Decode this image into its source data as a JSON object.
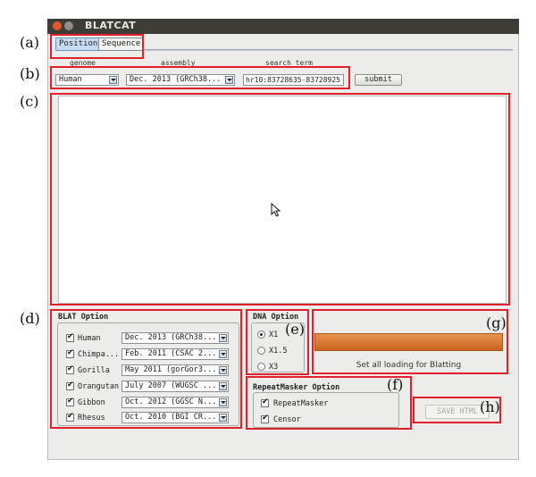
{
  "window": {
    "title": "BLATCAT"
  },
  "tabs": [
    {
      "label": "Position",
      "active": true
    },
    {
      "label": "Sequence",
      "active": false
    }
  ],
  "query": {
    "genome_label": "genome",
    "assembly_label": "assembly",
    "search_label": "search term",
    "genome_value": "Human",
    "assembly_value": "Dec. 2013 (GRCh38...",
    "search_value": "hr10:83728635-83728925",
    "submit_label": "submit"
  },
  "blat": {
    "title": "BLAT Option",
    "rows": [
      {
        "species": "Human",
        "assembly": "Dec. 2013 (GRCh38...",
        "checked": true
      },
      {
        "species": "Chimpa...",
        "assembly": "Feb. 2011 (CSAC 2...",
        "checked": true
      },
      {
        "species": "Gorilla",
        "assembly": "May 2011 (gorGor3...",
        "checked": true
      },
      {
        "species": "Orangutan",
        "assembly": "July 2007 (WUGSC ...",
        "checked": true
      },
      {
        "species": "Gibbon",
        "assembly": "Oct. 2012 (GGSC N...",
        "checked": true
      },
      {
        "species": "Rhesus",
        "assembly": "Oct. 2010 (BGI CR...",
        "checked": true
      }
    ]
  },
  "dna": {
    "title": "DNA Option",
    "options": [
      {
        "label": "X1",
        "selected": true
      },
      {
        "label": "X1.5",
        "selected": false
      },
      {
        "label": "X3",
        "selected": false
      }
    ]
  },
  "progress": {
    "value": 1.0,
    "status": "Set all loading for Blatting",
    "color": "#d8772f"
  },
  "repeatmasker": {
    "title": "RepeatMasker Option",
    "options": [
      {
        "label": "RepeatMasker",
        "checked": true
      },
      {
        "label": "Censor",
        "checked": true
      }
    ]
  },
  "save_html_label": "SAVE HTML",
  "markers": [
    "(a)",
    "(b)",
    "(c)",
    "(d)",
    "(e)",
    "(f)",
    "(g)",
    "(h)"
  ],
  "colors": {
    "annotation": "#e0202a",
    "titlebar": "#3d3c37",
    "tab_active": "#c6dcf3"
  }
}
